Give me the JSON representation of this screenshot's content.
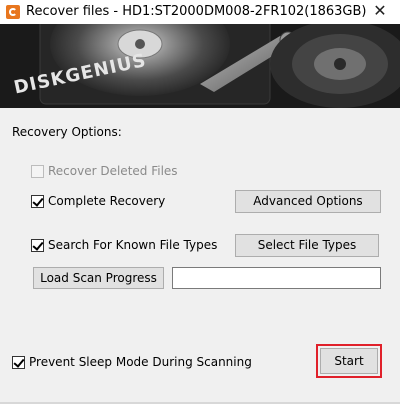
{
  "window": {
    "title": "Recover files - HD1:ST2000DM008-2FR102(1863GB)",
    "close_glyph": "✕"
  },
  "banner": {
    "logo_text": "DISKGENIUS"
  },
  "options": {
    "group_title": "Recovery Options:",
    "recover_deleted": {
      "label": "Recover Deleted Files",
      "checked": false,
      "enabled": false
    },
    "complete_recovery": {
      "label": "Complete Recovery",
      "checked": true,
      "enabled": true
    },
    "search_known_types": {
      "label": "Search For Known File Types",
      "checked": true,
      "enabled": true
    },
    "prevent_sleep": {
      "label": "Prevent Sleep Mode During Scanning",
      "checked": true,
      "enabled": true
    }
  },
  "buttons": {
    "advanced_options": "Advanced Options",
    "select_file_types": "Select File Types",
    "load_scan_progress": "Load Scan Progress",
    "start": "Start"
  },
  "scan_progress_path": {
    "value": ""
  },
  "colors": {
    "highlight": "#e0202a",
    "accent_icon": "#e8761e"
  }
}
